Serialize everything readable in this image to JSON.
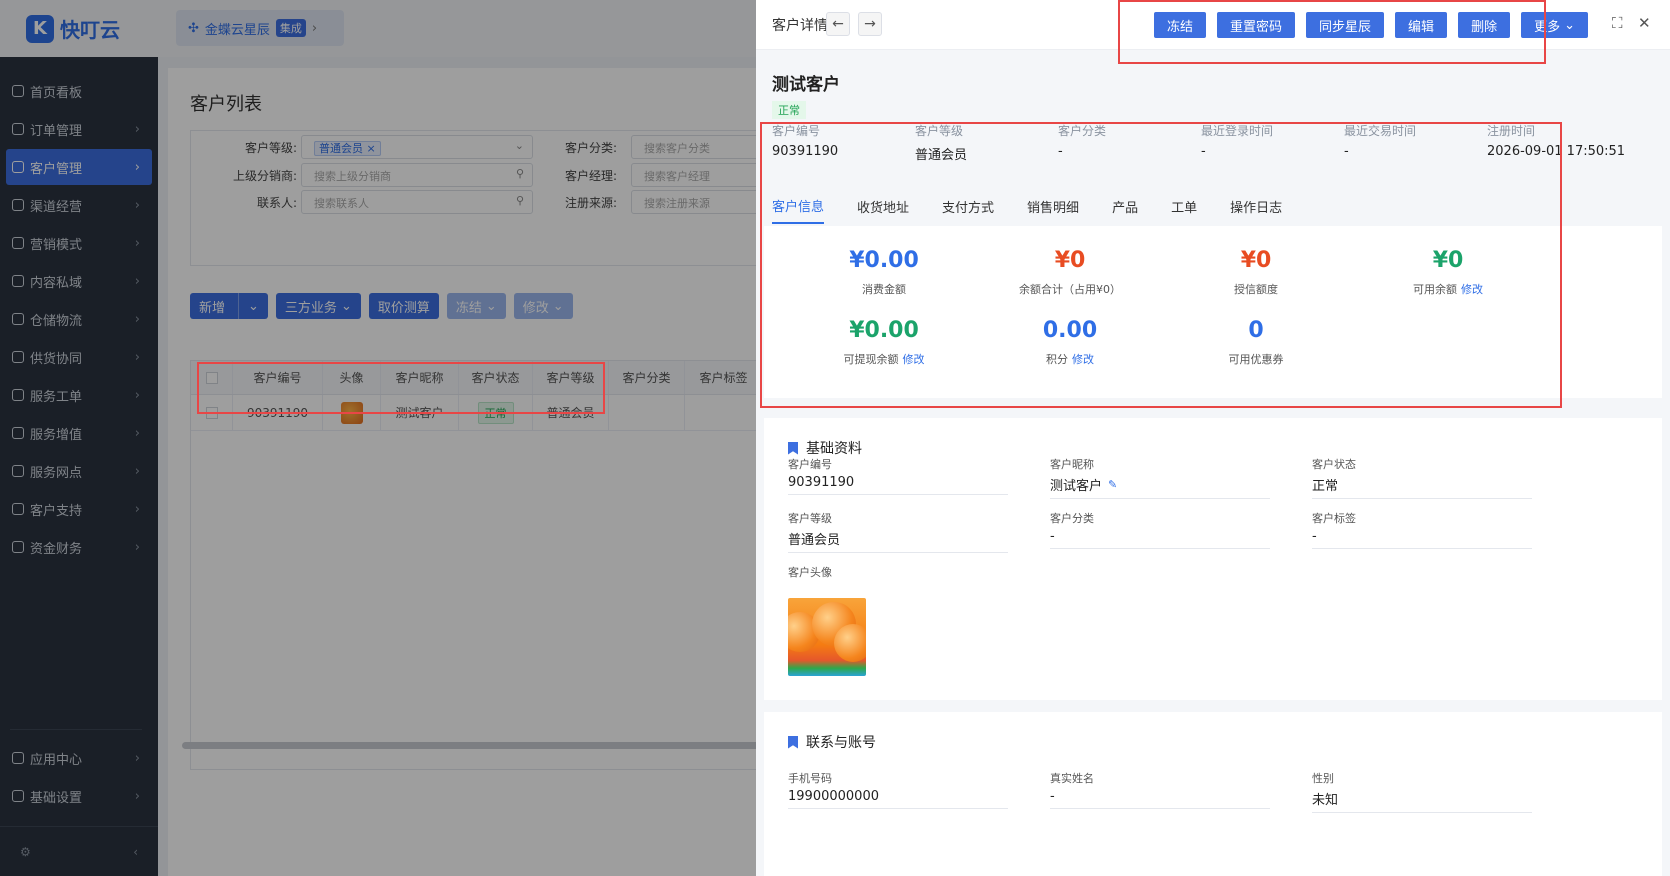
{
  "app": {
    "name": "快叮云",
    "logo_letter": "K"
  },
  "tenant": {
    "name": "金蝶云星辰",
    "badge": "集成"
  },
  "sidebar": {
    "items": [
      {
        "label": "首页看板",
        "icon": "home-icon"
      },
      {
        "label": "订单管理",
        "icon": "order-icon"
      },
      {
        "label": "客户管理",
        "icon": "user-icon",
        "active": true
      },
      {
        "label": "渠道经营",
        "icon": "channel-icon"
      },
      {
        "label": "营销模式",
        "icon": "tag-icon"
      },
      {
        "label": "内容私域",
        "icon": "mail-icon"
      },
      {
        "label": "仓储物流",
        "icon": "warehouse-icon"
      },
      {
        "label": "供货协同",
        "icon": "supply-icon"
      },
      {
        "label": "服务工单",
        "icon": "ticket-icon"
      },
      {
        "label": "服务增值",
        "icon": "bag-icon"
      },
      {
        "label": "服务网点",
        "icon": "store-icon"
      },
      {
        "label": "客户支持",
        "icon": "support-icon"
      },
      {
        "label": "资金财务",
        "icon": "finance-icon"
      }
    ],
    "bottom_items": [
      {
        "label": "应用中心",
        "icon": "apps-icon"
      },
      {
        "label": "基础设置",
        "icon": "settings-icon"
      }
    ]
  },
  "list_page": {
    "title": "客户列表",
    "filters": {
      "level_label": "客户等级:",
      "level_tag": "普通会员",
      "upper_label": "上级分销商:",
      "upper_placeholder": "搜索上级分销商",
      "contact_label": "联系人:",
      "contact_placeholder": "搜索联系人",
      "category_label": "客户分类:",
      "category_placeholder": "搜索客户分类",
      "manager_label": "客户经理:",
      "manager_placeholder": "搜索客户经理",
      "source_label": "注册来源:",
      "source_placeholder": "搜索注册来源"
    },
    "actions": {
      "add": "新增",
      "third": "三方业务",
      "price": "取价测算",
      "freeze": "冻结",
      "modify": "修改"
    },
    "columns": [
      "客户编号",
      "头像",
      "客户昵称",
      "客户状态",
      "客户等级",
      "客户分类",
      "客户标签"
    ],
    "row": {
      "id": "90391190",
      "nickname": "测试客户",
      "status": "正常",
      "level": "普通会员"
    }
  },
  "drawer": {
    "title": "客户详情",
    "buttons": {
      "freeze": "冻结",
      "reset": "重置密码",
      "sync": "同步星辰",
      "edit": "编辑",
      "delete": "删除",
      "more": "更多"
    },
    "name": "测试客户",
    "status": "正常",
    "summary": [
      {
        "label": "客户编号",
        "value": "90391190"
      },
      {
        "label": "客户等级",
        "value": "普通会员"
      },
      {
        "label": "客户分类",
        "value": "-"
      },
      {
        "label": "最近登录时间",
        "value": "-"
      },
      {
        "label": "最近交易时间",
        "value": "-"
      },
      {
        "label": "注册时间",
        "value": "2026-09-01 17:50:51"
      }
    ],
    "tabs": [
      "客户信息",
      "收货地址",
      "支付方式",
      "销售明细",
      "产品",
      "工单",
      "操作日志"
    ],
    "stats": [
      {
        "value": "¥0.00",
        "label": "消费金额",
        "color": "#2f6ee6"
      },
      {
        "value": "¥0",
        "label": "余额合计（占用¥0）",
        "color": "#e84c22"
      },
      {
        "value": "¥0",
        "label": "授信额度",
        "color": "#e84c22"
      },
      {
        "value": "¥0",
        "label": "可用余额",
        "link": "修改",
        "color": "#1ba36a"
      },
      {
        "value": "¥0.00",
        "label": "可提现余额",
        "link": "修改",
        "color": "#1ba36a"
      },
      {
        "value": "0.00",
        "label": "积分",
        "link": "修改",
        "color": "#2f6ee6"
      },
      {
        "value": "0",
        "label": "可用优惠券",
        "color": "#2f6ee6"
      }
    ],
    "basic": {
      "title": "基础资料",
      "fields": [
        {
          "label": "客户编号",
          "value": "90391190"
        },
        {
          "label": "客户昵称",
          "value": "测试客户"
        },
        {
          "label": "客户状态",
          "value": "正常"
        },
        {
          "label": "客户等级",
          "value": "普通会员"
        },
        {
          "label": "客户分类",
          "value": "-"
        },
        {
          "label": "客户标签",
          "value": "-"
        }
      ],
      "avatar_label": "客户头像"
    },
    "contact": {
      "title": "联系与账号",
      "fields": [
        {
          "label": "手机号码",
          "value": "19900000000"
        },
        {
          "label": "真实姓名",
          "value": "-"
        },
        {
          "label": "性别",
          "value": "未知"
        }
      ]
    }
  }
}
